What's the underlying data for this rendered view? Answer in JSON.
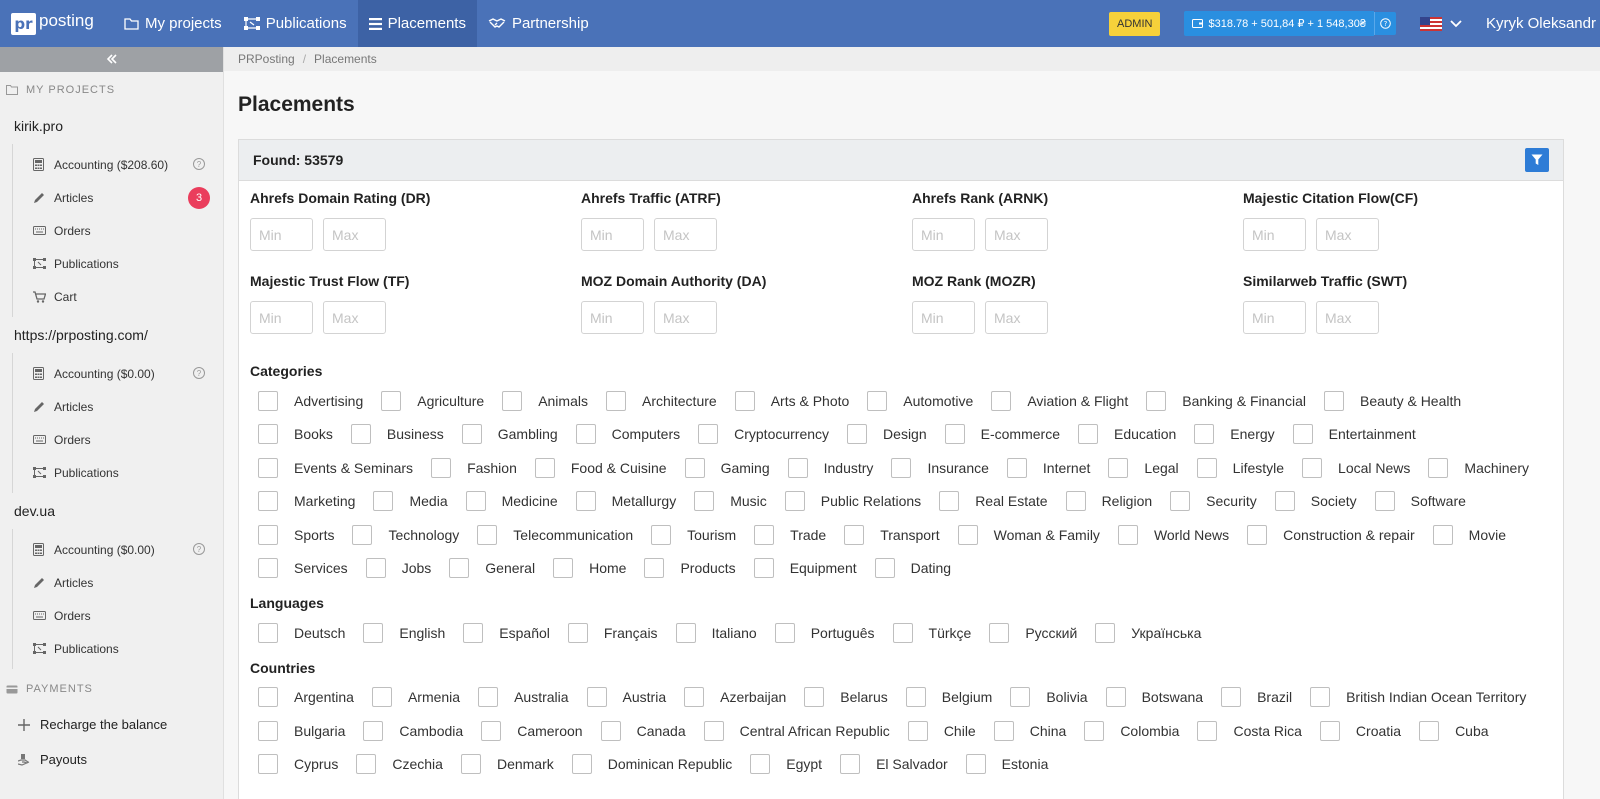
{
  "app": {
    "logo_mark": "pr",
    "logo_text": "posting"
  },
  "nav": [
    {
      "label": "My projects",
      "icon": "folder-icon"
    },
    {
      "label": "Publications",
      "icon": "network-icon"
    },
    {
      "label": "Placements",
      "icon": "list-icon",
      "active": true
    },
    {
      "label": "Partnership",
      "icon": "handshake-icon"
    }
  ],
  "top_right": {
    "admin_label": "ADMIN",
    "balance": "$318.78 + 501,84 ₽ + 1 548,30₴",
    "user_name": "Kyryk Oleksandr"
  },
  "sidebar": {
    "my_projects_label": "MY PROJECTS",
    "projects": [
      {
        "name": "kirik.pro",
        "items": [
          {
            "label": "Accounting ($208.60)",
            "icon": "calculator-icon",
            "help": true
          },
          {
            "label": "Articles",
            "icon": "pencil-icon",
            "badge": "3"
          },
          {
            "label": "Orders",
            "icon": "keyboard-icon"
          },
          {
            "label": "Publications",
            "icon": "network-icon"
          },
          {
            "label": "Cart",
            "icon": "cart-icon"
          }
        ]
      },
      {
        "name": "https://prposting.com/",
        "items": [
          {
            "label": "Accounting ($0.00)",
            "icon": "calculator-icon",
            "help": true
          },
          {
            "label": "Articles",
            "icon": "pencil-icon"
          },
          {
            "label": "Orders",
            "icon": "keyboard-icon"
          },
          {
            "label": "Publications",
            "icon": "network-icon"
          }
        ]
      },
      {
        "name": "dev.ua",
        "items": [
          {
            "label": "Accounting ($0.00)",
            "icon": "calculator-icon",
            "help": true
          },
          {
            "label": "Articles",
            "icon": "pencil-icon"
          },
          {
            "label": "Orders",
            "icon": "keyboard-icon"
          },
          {
            "label": "Publications",
            "icon": "network-icon"
          }
        ]
      }
    ],
    "payments_label": "PAYMENTS",
    "payments": [
      {
        "label": "Recharge the balance",
        "icon": "plus-icon"
      },
      {
        "label": "Payouts",
        "icon": "payout-icon"
      }
    ]
  },
  "breadcrumb": [
    "PRPosting",
    "Placements"
  ],
  "page_title": "Placements",
  "found_label": "Found: 53579",
  "metrics": [
    {
      "label": "Ahrefs Domain Rating (DR)"
    },
    {
      "label": "Ahrefs Traffic (ATRF)"
    },
    {
      "label": "Ahrefs Rank (ARNK)"
    },
    {
      "label": "Majestic Citation Flow(CF)"
    },
    {
      "label": "Majestic Trust Flow (TF)"
    },
    {
      "label": "MOZ Domain Authority (DA)"
    },
    {
      "label": "MOZ Rank (MOZR)"
    },
    {
      "label": "Similarweb Traffic (SWT)"
    }
  ],
  "min_placeholder": "Min",
  "max_placeholder": "Max",
  "categories_label": "Categories",
  "categories": [
    "Advertising",
    "Agriculture",
    "Animals",
    "Architecture",
    "Arts & Photo",
    "Automotive",
    "Aviation & Flight",
    "Banking & Financial",
    "Beauty & Health",
    "Books",
    "Business",
    "Gambling",
    "Computers",
    "Cryptocurrency",
    "Design",
    "E-commerce",
    "Education",
    "Energy",
    "Entertainment",
    "Events & Seminars",
    "Fashion",
    "Food & Cuisine",
    "Gaming",
    "Industry",
    "Insurance",
    "Internet",
    "Legal",
    "Lifestyle",
    "Local News",
    "Machinery",
    "Marketing",
    "Media",
    "Medicine",
    "Metallurgy",
    "Music",
    "Public Relations",
    "Real Estate",
    "Religion",
    "Security",
    "Society",
    "Software",
    "Sports",
    "Technology",
    "Telecommunication",
    "Tourism",
    "Trade",
    "Transport",
    "Woman & Family",
    "World News",
    "Construction & repair",
    "Movie",
    "Services",
    "Jobs",
    "General",
    "Home",
    "Products",
    "Equipment",
    "Dating"
  ],
  "languages_label": "Languages",
  "languages": [
    "Deutsch",
    "English",
    "Español",
    "Français",
    "Italiano",
    "Português",
    "Türkçe",
    "Русский",
    "Українська"
  ],
  "countries_label": "Countries",
  "countries": [
    "Argentina",
    "Armenia",
    "Australia",
    "Austria",
    "Azerbaijan",
    "Belarus",
    "Belgium",
    "Bolivia",
    "Botswana",
    "Brazil",
    "British Indian Ocean Territory",
    "Bulgaria",
    "Cambodia",
    "Cameroon",
    "Canada",
    "Central African Republic",
    "Chile",
    "China",
    "Colombia",
    "Costa Rica",
    "Croatia",
    "Cuba",
    "Cyprus",
    "Czechia",
    "Denmark",
    "Dominican Republic",
    "Egypt",
    "El Salvador",
    "Estonia"
  ],
  "colors": {
    "topbar": "#4a72b8",
    "accent": "#2e7cd6",
    "admin": "#f6d13a",
    "badge": "#ea3d5c"
  }
}
